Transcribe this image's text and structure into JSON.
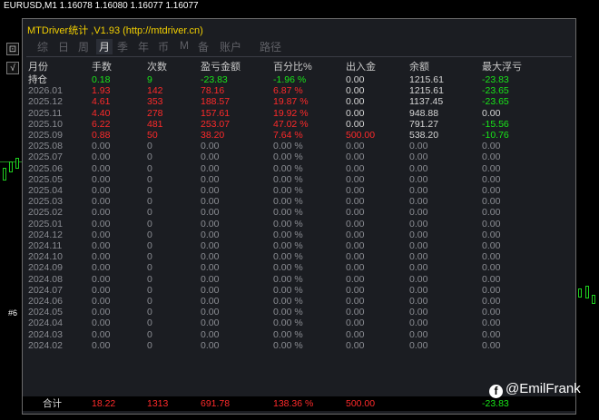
{
  "chart": {
    "title": "EURUSD,M1  1.16078 1.16080 1.16077 1.16077",
    "left_label": "#6"
  },
  "panel": {
    "title": "MTDriver统计 ,V1.93 (http://mtdriver.cn)",
    "tabs": [
      "综",
      "日",
      "周",
      "月",
      "季",
      "年",
      "币",
      "M",
      "备",
      "账户",
      "路径"
    ],
    "active_tab": "月",
    "headers": [
      "月份",
      "手数",
      "次数",
      "盈亏金额",
      "百分比%",
      "出入金",
      "余额",
      "最大浮亏"
    ],
    "rows": [
      [
        "持仓",
        "0.18",
        "9",
        "-23.83",
        "-1.96 %",
        "0.00",
        "1215.61",
        "-23.83"
      ],
      [
        "2026.01",
        "1.93",
        "142",
        "78.16",
        "6.87 %",
        "0.00",
        "1215.61",
        "-23.65"
      ],
      [
        "2025.12",
        "4.61",
        "353",
        "188.57",
        "19.87 %",
        "0.00",
        "1137.45",
        "-23.65"
      ],
      [
        "2025.11",
        "4.40",
        "278",
        "157.61",
        "19.92 %",
        "0.00",
        "948.88",
        "0.00"
      ],
      [
        "2025.10",
        "6.22",
        "481",
        "253.07",
        "47.02 %",
        "0.00",
        "791.27",
        "-15.56"
      ],
      [
        "2025.09",
        "0.88",
        "50",
        "38.20",
        "7.64 %",
        "500.00",
        "538.20",
        "-10.76"
      ],
      [
        "2025.08",
        "0.00",
        "0",
        "0.00",
        "0.00 %",
        "0.00",
        "0.00",
        "0.00"
      ],
      [
        "2025.07",
        "0.00",
        "0",
        "0.00",
        "0.00 %",
        "0.00",
        "0.00",
        "0.00"
      ],
      [
        "2025.06",
        "0.00",
        "0",
        "0.00",
        "0.00 %",
        "0.00",
        "0.00",
        "0.00"
      ],
      [
        "2025.05",
        "0.00",
        "0",
        "0.00",
        "0.00 %",
        "0.00",
        "0.00",
        "0.00"
      ],
      [
        "2025.04",
        "0.00",
        "0",
        "0.00",
        "0.00 %",
        "0.00",
        "0.00",
        "0.00"
      ],
      [
        "2025.03",
        "0.00",
        "0",
        "0.00",
        "0.00 %",
        "0.00",
        "0.00",
        "0.00"
      ],
      [
        "2025.02",
        "0.00",
        "0",
        "0.00",
        "0.00 %",
        "0.00",
        "0.00",
        "0.00"
      ],
      [
        "2025.01",
        "0.00",
        "0",
        "0.00",
        "0.00 %",
        "0.00",
        "0.00",
        "0.00"
      ],
      [
        "2024.12",
        "0.00",
        "0",
        "0.00",
        "0.00 %",
        "0.00",
        "0.00",
        "0.00"
      ],
      [
        "2024.11",
        "0.00",
        "0",
        "0.00",
        "0.00 %",
        "0.00",
        "0.00",
        "0.00"
      ],
      [
        "2024.10",
        "0.00",
        "0",
        "0.00",
        "0.00 %",
        "0.00",
        "0.00",
        "0.00"
      ],
      [
        "2024.09",
        "0.00",
        "0",
        "0.00",
        "0.00 %",
        "0.00",
        "0.00",
        "0.00"
      ],
      [
        "2024.08",
        "0.00",
        "0",
        "0.00",
        "0.00 %",
        "0.00",
        "0.00",
        "0.00"
      ],
      [
        "2024.07",
        "0.00",
        "0",
        "0.00",
        "0.00 %",
        "0.00",
        "0.00",
        "0.00"
      ],
      [
        "2024.06",
        "0.00",
        "0",
        "0.00",
        "0.00 %",
        "0.00",
        "0.00",
        "0.00"
      ],
      [
        "2024.05",
        "0.00",
        "0",
        "0.00",
        "0.00 %",
        "0.00",
        "0.00",
        "0.00"
      ],
      [
        "2024.04",
        "0.00",
        "0",
        "0.00",
        "0.00 %",
        "0.00",
        "0.00",
        "0.00"
      ],
      [
        "2024.03",
        "0.00",
        "0",
        "0.00",
        "0.00 %",
        "0.00",
        "0.00",
        "0.00"
      ],
      [
        "2024.02",
        "0.00",
        "0",
        "0.00",
        "0.00 %",
        "0.00",
        "0.00",
        "0.00"
      ]
    ],
    "total": {
      "label": "合计",
      "lots": "18.22",
      "count": "1313",
      "profit": "691.78",
      "pct": "138.36 %",
      "flow": "500.00",
      "dd": "-23.83"
    }
  },
  "watermark": {
    "icon": "facebook-icon",
    "text": "@EmilFrank"
  },
  "colors": {
    "title": "#f3d000",
    "loss": "#ff2a2a",
    "gain": "#19e619",
    "panel_bg": "#1b1d22"
  }
}
